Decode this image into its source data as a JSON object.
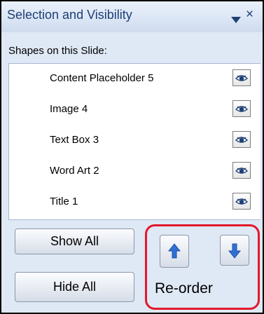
{
  "pane": {
    "title": "Selection and Visibility",
    "shapes_label": "Shapes on this Slide:",
    "close_glyph": "×",
    "menu_icon": "chevron-down-icon"
  },
  "shapes": [
    {
      "label": "Content Placeholder 5",
      "visible": true
    },
    {
      "label": "Image 4",
      "visible": true
    },
    {
      "label": "Text Box 3",
      "visible": true
    },
    {
      "label": "Word Art 2",
      "visible": true
    },
    {
      "label": "Title 1",
      "visible": true
    }
  ],
  "buttons": {
    "show_all": "Show All",
    "hide_all": "Hide All"
  },
  "reorder": {
    "label": "Re-order",
    "up_icon": "arrow-up-icon",
    "down_icon": "arrow-down-icon",
    "highlight_color": "#e2192b"
  },
  "colors": {
    "pane_background": "#dfe8f5",
    "title_text": "#1f3f75",
    "arrow_fill": "#2f6fd6"
  }
}
